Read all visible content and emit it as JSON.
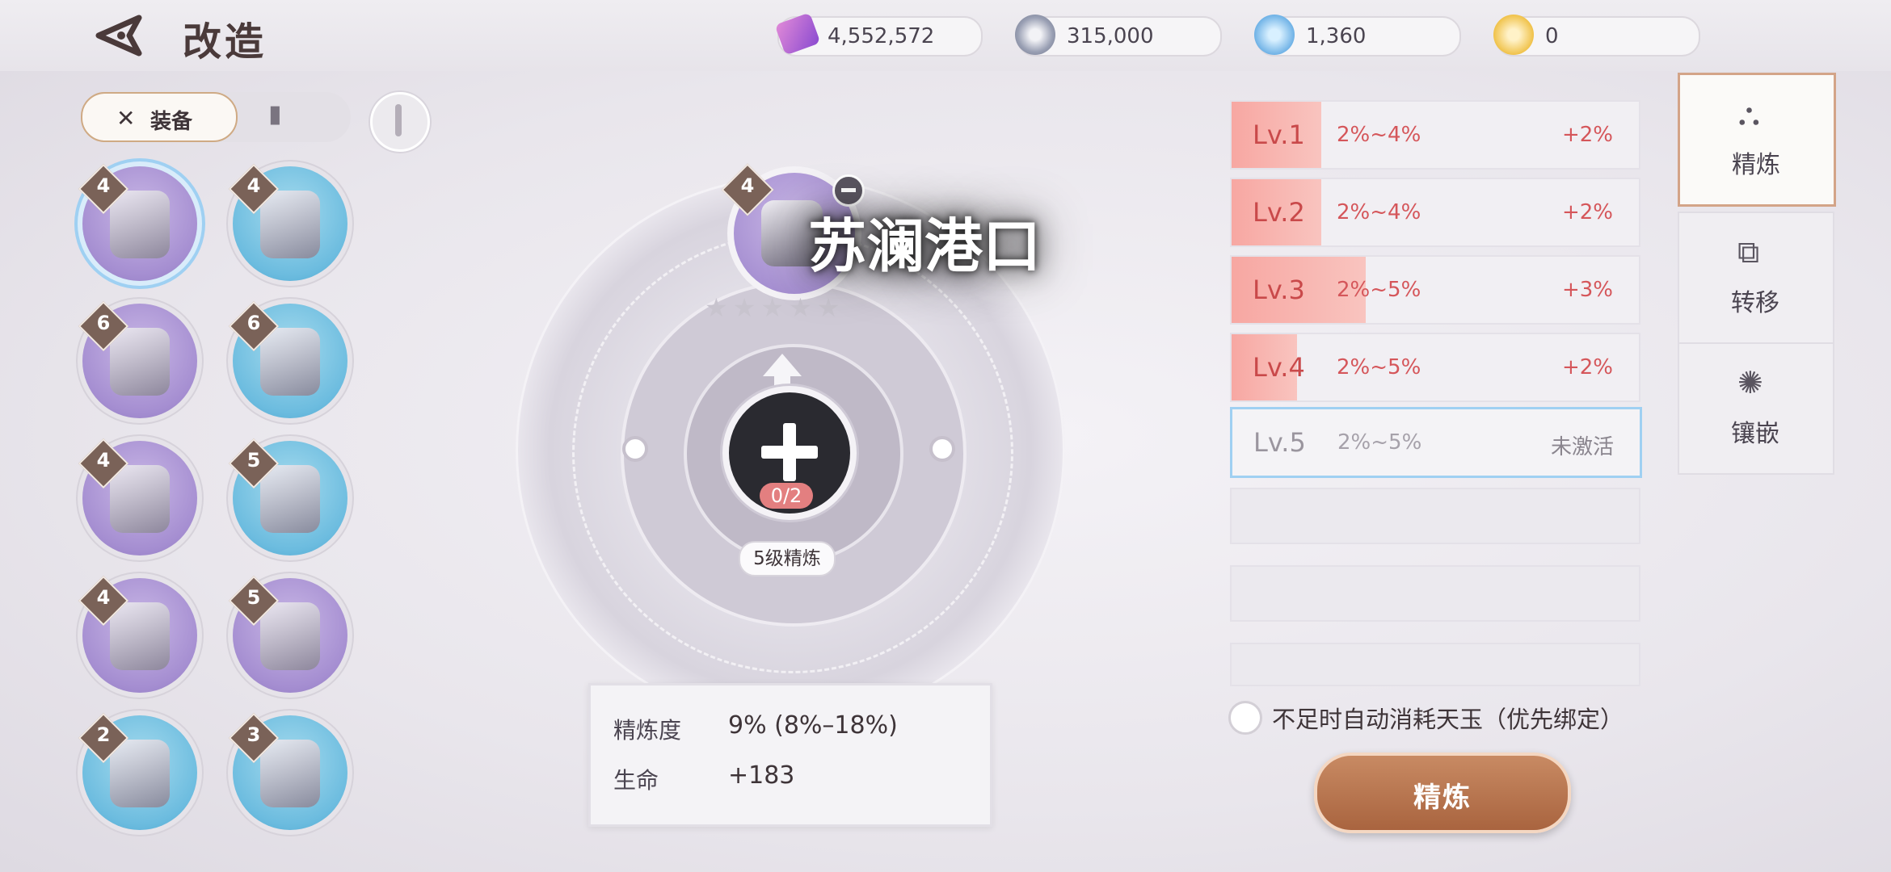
{
  "header": {
    "title": "改造"
  },
  "currencies": [
    {
      "icon": "gem-ticket-icon",
      "value": "4,552,572"
    },
    {
      "icon": "silver-coin-icon",
      "value": "315,000"
    },
    {
      "icon": "blue-jade-icon",
      "value": "1,360"
    },
    {
      "icon": "gold-jade-icon",
      "value": "0"
    }
  ],
  "tabs": {
    "equip_label": "装备"
  },
  "equipment": [
    {
      "level": "4",
      "type": "helmet",
      "rarity": "purple"
    },
    {
      "level": "4",
      "type": "gloves",
      "rarity": "blue"
    },
    {
      "level": "6",
      "type": "armor",
      "rarity": "purple"
    },
    {
      "level": "6",
      "type": "necklace",
      "rarity": "blue"
    },
    {
      "level": "4",
      "type": "pants",
      "rarity": "purple"
    },
    {
      "level": "5",
      "type": "earring",
      "rarity": "blue"
    },
    {
      "level": "4",
      "type": "boots",
      "rarity": "purple"
    },
    {
      "level": "5",
      "type": "ring",
      "rarity": "purple"
    },
    {
      "level": "2",
      "type": "weapon",
      "rarity": "blue"
    },
    {
      "level": "3",
      "type": "charm",
      "rarity": "blue"
    }
  ],
  "selected_item": {
    "level": "4",
    "stars": 5,
    "lit_stars": 0
  },
  "watermark": "苏澜港口",
  "material": {
    "count": "0/2",
    "refine_label": "5级精炼"
  },
  "stats": [
    {
      "key": "精炼度",
      "value": "9% (8%–18%)"
    },
    {
      "key": "生命",
      "value": "+183"
    }
  ],
  "refine_levels": [
    {
      "level": "Lv.1",
      "range": "2%~4%",
      "bonus": "+2%",
      "progress": 0.22,
      "active": true
    },
    {
      "level": "Lv.2",
      "range": "2%~4%",
      "bonus": "+2%",
      "progress": 0.22,
      "active": true
    },
    {
      "level": "Lv.3",
      "range": "2%~5%",
      "bonus": "+3%",
      "progress": 0.33,
      "active": true
    },
    {
      "level": "Lv.4",
      "range": "2%~5%",
      "bonus": "+2%",
      "progress": 0.16,
      "active": true
    },
    {
      "level": "Lv.5",
      "range": "2%~5%",
      "bonus": "未激活",
      "progress": 0,
      "active": false
    }
  ],
  "side_nav": [
    {
      "label": "精炼",
      "icon": "refine-icon",
      "active": true
    },
    {
      "label": "转移",
      "icon": "transfer-icon",
      "active": false
    },
    {
      "label": "镶嵌",
      "icon": "inlay-icon",
      "active": false
    }
  ],
  "auto_consume": {
    "label": "不足时自动消耗天玉（优先绑定）",
    "checked": false
  },
  "refine_button": "精炼",
  "colors": {
    "accent": "#b06c46",
    "level_fill": "#f7a7a2",
    "inactive_border": "#9fd0f2"
  }
}
